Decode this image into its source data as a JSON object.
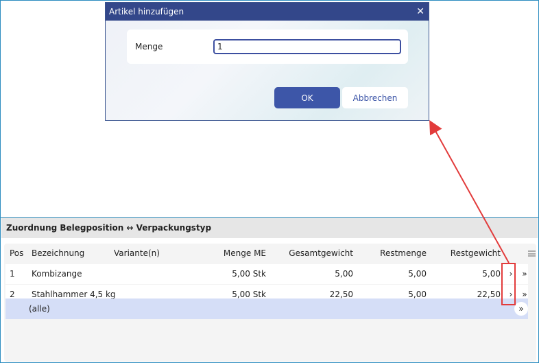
{
  "dialog": {
    "title": "Artikel hinzufügen",
    "close_glyph": "✕",
    "field_label": "Menge",
    "field_value": "1",
    "ok_label": "OK",
    "cancel_label": "Abbrechen"
  },
  "section": {
    "title": "Zuordnung Belegposition ↔ Verpackungstyp"
  },
  "table": {
    "columns": {
      "pos": "Pos",
      "bezeichnung": "Bezeichnung",
      "variante": "Variante(n)",
      "menge": "Menge ME",
      "gesamtgewicht": "Gesamtgewicht",
      "restmenge": "Restmenge",
      "restgewicht": "Restgewicht"
    },
    "rows": [
      {
        "pos": "1",
        "bezeichnung": "Kombizange",
        "variante": "",
        "menge": "5,00 Stk",
        "gesamtgewicht": "5,00",
        "restmenge": "5,00",
        "restgewicht": "5,00"
      },
      {
        "pos": "2",
        "bezeichnung": "Stahlhammer 4,5 kg",
        "variante": "",
        "menge": "5,00 Stk",
        "gesamtgewicht": "22,50",
        "restmenge": "5,00",
        "restgewicht": "22,50"
      }
    ],
    "single_glyph": "›",
    "double_glyph": "»",
    "all_label": "(alle)"
  },
  "colors": {
    "accent": "#3d56a8",
    "titlebar": "#33478a",
    "highlight": "#e23b3b",
    "all_row": "#d5def7"
  },
  "icons": {
    "close": "close-icon",
    "menu": "menu-icon",
    "arrow": "chevron-right-icon",
    "double_arrow": "double-chevron-right-icon"
  }
}
